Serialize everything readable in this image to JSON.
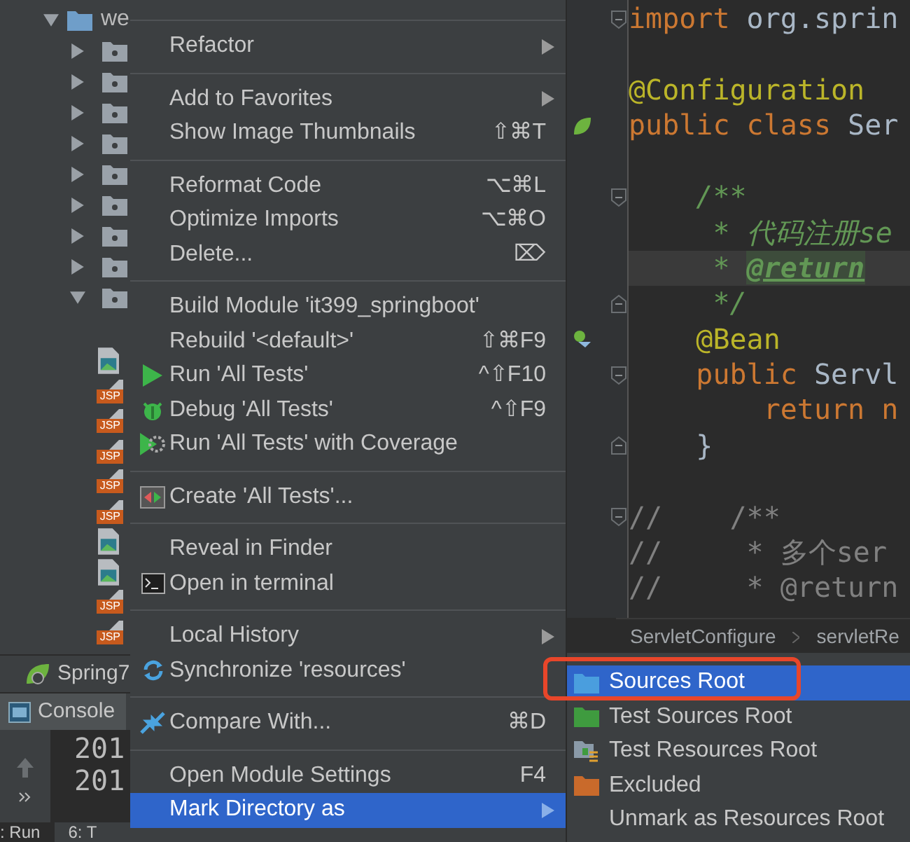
{
  "project_tree": {
    "items": [
      {
        "label": "we",
        "kind": "folder",
        "expanded": true,
        "children": [
          {
            "kind": "folder",
            "expanded": false
          },
          {
            "kind": "folder",
            "expanded": false
          },
          {
            "kind": "folder",
            "expanded": false
          },
          {
            "kind": "folder",
            "expanded": false
          },
          {
            "kind": "folder",
            "expanded": false
          },
          {
            "kind": "folder",
            "expanded": false
          },
          {
            "kind": "folder",
            "expanded": false
          },
          {
            "kind": "folder",
            "expanded": false
          },
          {
            "kind": "folder",
            "expanded": true,
            "children": [
              {
                "kind": "image"
              },
              {
                "kind": "jsp",
                "label": "JSP"
              },
              {
                "kind": "jsp",
                "label": "JSP"
              },
              {
                "kind": "jsp",
                "label": "JSP"
              },
              {
                "kind": "jsp",
                "label": "JSP"
              },
              {
                "kind": "jsp",
                "label": "JSP"
              },
              {
                "kind": "image"
              },
              {
                "kind": "image"
              },
              {
                "kind": "jsp",
                "label": "JSP"
              },
              {
                "kind": "jsp",
                "label": "JSP"
              }
            ]
          }
        ]
      }
    ]
  },
  "editor": {
    "lines": [
      {
        "kind": "code",
        "segments": [
          {
            "text": "import ",
            "kind": "keyword"
          },
          {
            "text": "org.sprin",
            "kind": "plain"
          }
        ],
        "fold": {
          "kind": "start"
        },
        "current": false
      },
      {
        "kind": "blank",
        "current": false
      },
      {
        "kind": "code",
        "segments": [
          {
            "text": "@Configuration",
            "kind": "annotation"
          }
        ],
        "current": false
      },
      {
        "kind": "code",
        "segments": [
          {
            "text": "public class ",
            "kind": "keyword"
          },
          {
            "text": "Ser",
            "kind": "plain"
          }
        ],
        "gutter_icon": {
          "kind": "leaf"
        },
        "current": false
      },
      {
        "kind": "blank",
        "current": false
      },
      {
        "kind": "code",
        "segments": [
          {
            "text": "    /**",
            "kind": "doc"
          }
        ],
        "fold": {
          "kind": "start"
        },
        "current": false
      },
      {
        "kind": "code",
        "segments": [
          {
            "text": "     * 代码注册se",
            "kind": "doc"
          }
        ],
        "current": false
      },
      {
        "kind": "code",
        "segments": [
          {
            "text": "     * ",
            "kind": "doc"
          },
          {
            "text": "@return",
            "kind": "doc_tag"
          }
        ],
        "current": true
      },
      {
        "kind": "code",
        "segments": [
          {
            "text": "     */",
            "kind": "doc"
          }
        ],
        "fold": {
          "kind": "end"
        },
        "current": false
      },
      {
        "kind": "code",
        "segments": [
          {
            "text": "    @Bean",
            "kind": "annotation"
          }
        ],
        "gutter_icon": {
          "kind": "bean"
        },
        "current": false
      },
      {
        "kind": "code",
        "segments": [
          {
            "text": "    public ",
            "kind": "keyword"
          },
          {
            "text": "Servl",
            "kind": "plain"
          }
        ],
        "fold": {
          "kind": "start"
        },
        "current": false
      },
      {
        "kind": "code",
        "segments": [
          {
            "text": "        return ",
            "kind": "keyword"
          },
          {
            "text": "n",
            "kind": "keyword"
          }
        ],
        "current": false
      },
      {
        "kind": "code",
        "segments": [
          {
            "text": "    }",
            "kind": "plain"
          }
        ],
        "fold": {
          "kind": "end"
        },
        "current": false
      },
      {
        "kind": "blank",
        "current": false
      },
      {
        "kind": "code",
        "segments": [
          {
            "text": "//    /**",
            "kind": "comment"
          }
        ],
        "fold": {
          "kind": "start"
        },
        "current": false
      },
      {
        "kind": "code",
        "segments": [
          {
            "text": "//     * 多个ser",
            "kind": "comment"
          }
        ],
        "current": false
      },
      {
        "kind": "code",
        "segments": [
          {
            "text": "//     * @return",
            "kind": "comment"
          }
        ],
        "current": false
      }
    ],
    "breadcrumb": [
      "ServletConfigure",
      "servletRe"
    ]
  },
  "run_tabs": [
    {
      "label": "Spring7",
      "selected": false
    },
    {
      "label": "Console",
      "selected": true
    }
  ],
  "console": {
    "lines": [
      "201",
      "201"
    ]
  },
  "status_bar": [
    {
      "label": ": Run"
    },
    {
      "label": "6: T"
    }
  ],
  "context_menu": {
    "groups": [
      [
        {
          "label": "Refactor",
          "submenu": true,
          "selected": false
        }
      ],
      [
        {
          "label": "Add to Favorites",
          "submenu": true,
          "selected": false
        },
        {
          "label": "Show Image Thumbnails",
          "shortcut": "⇧⌘T",
          "selected": false
        }
      ],
      [
        {
          "label": "Reformat Code",
          "shortcut": "⌥⌘L",
          "selected": false
        },
        {
          "label": "Optimize Imports",
          "shortcut": "⌥⌘O",
          "selected": false
        },
        {
          "label": "Delete...",
          "shortcut": "⌦",
          "selected": false
        }
      ],
      [
        {
          "label": "Build Module 'it399_springboot'",
          "selected": false
        },
        {
          "label": "Rebuild '<default>'",
          "shortcut": "⇧⌘F9",
          "selected": false
        },
        {
          "label": "Run 'All Tests'",
          "kind": "run",
          "shortcut": "^⇧F10",
          "selected": false
        },
        {
          "label": "Debug 'All Tests'",
          "kind": "debug",
          "shortcut": "^⇧F9",
          "selected": false
        },
        {
          "label": "Run 'All Tests' with Coverage",
          "kind": "coverage",
          "selected": false
        }
      ],
      [
        {
          "label": "Create 'All Tests'...",
          "kind": "create",
          "selected": false
        }
      ],
      [
        {
          "label": "Reveal in Finder",
          "selected": false
        },
        {
          "label": "Open in terminal",
          "kind": "terminal",
          "selected": false
        }
      ],
      [
        {
          "label": "Local History",
          "submenu": true,
          "selected": false
        },
        {
          "label": "Synchronize 'resources'",
          "kind": "sync",
          "selected": false
        }
      ],
      [
        {
          "label": "Compare With...",
          "kind": "compare",
          "shortcut": "⌘D",
          "selected": false
        }
      ],
      [
        {
          "label": "Open Module Settings",
          "shortcut": "F4",
          "selected": false
        },
        {
          "label": "Mark Directory as",
          "submenu": true,
          "selected": true
        }
      ]
    ]
  },
  "submenu": {
    "items": [
      {
        "label": "Sources Root",
        "kind": "sources",
        "selected": true,
        "outlined": true
      },
      {
        "label": "Test Sources Root",
        "kind": "test_sources",
        "selected": false,
        "outlined": false
      },
      {
        "label": "Test Resources Root",
        "kind": "test_resources",
        "selected": false,
        "outlined": false
      },
      {
        "label": "Excluded",
        "kind": "excluded",
        "selected": false,
        "outlined": false
      },
      {
        "label": "Unmark as Resources Root",
        "selected": false,
        "outlined": false
      }
    ]
  }
}
